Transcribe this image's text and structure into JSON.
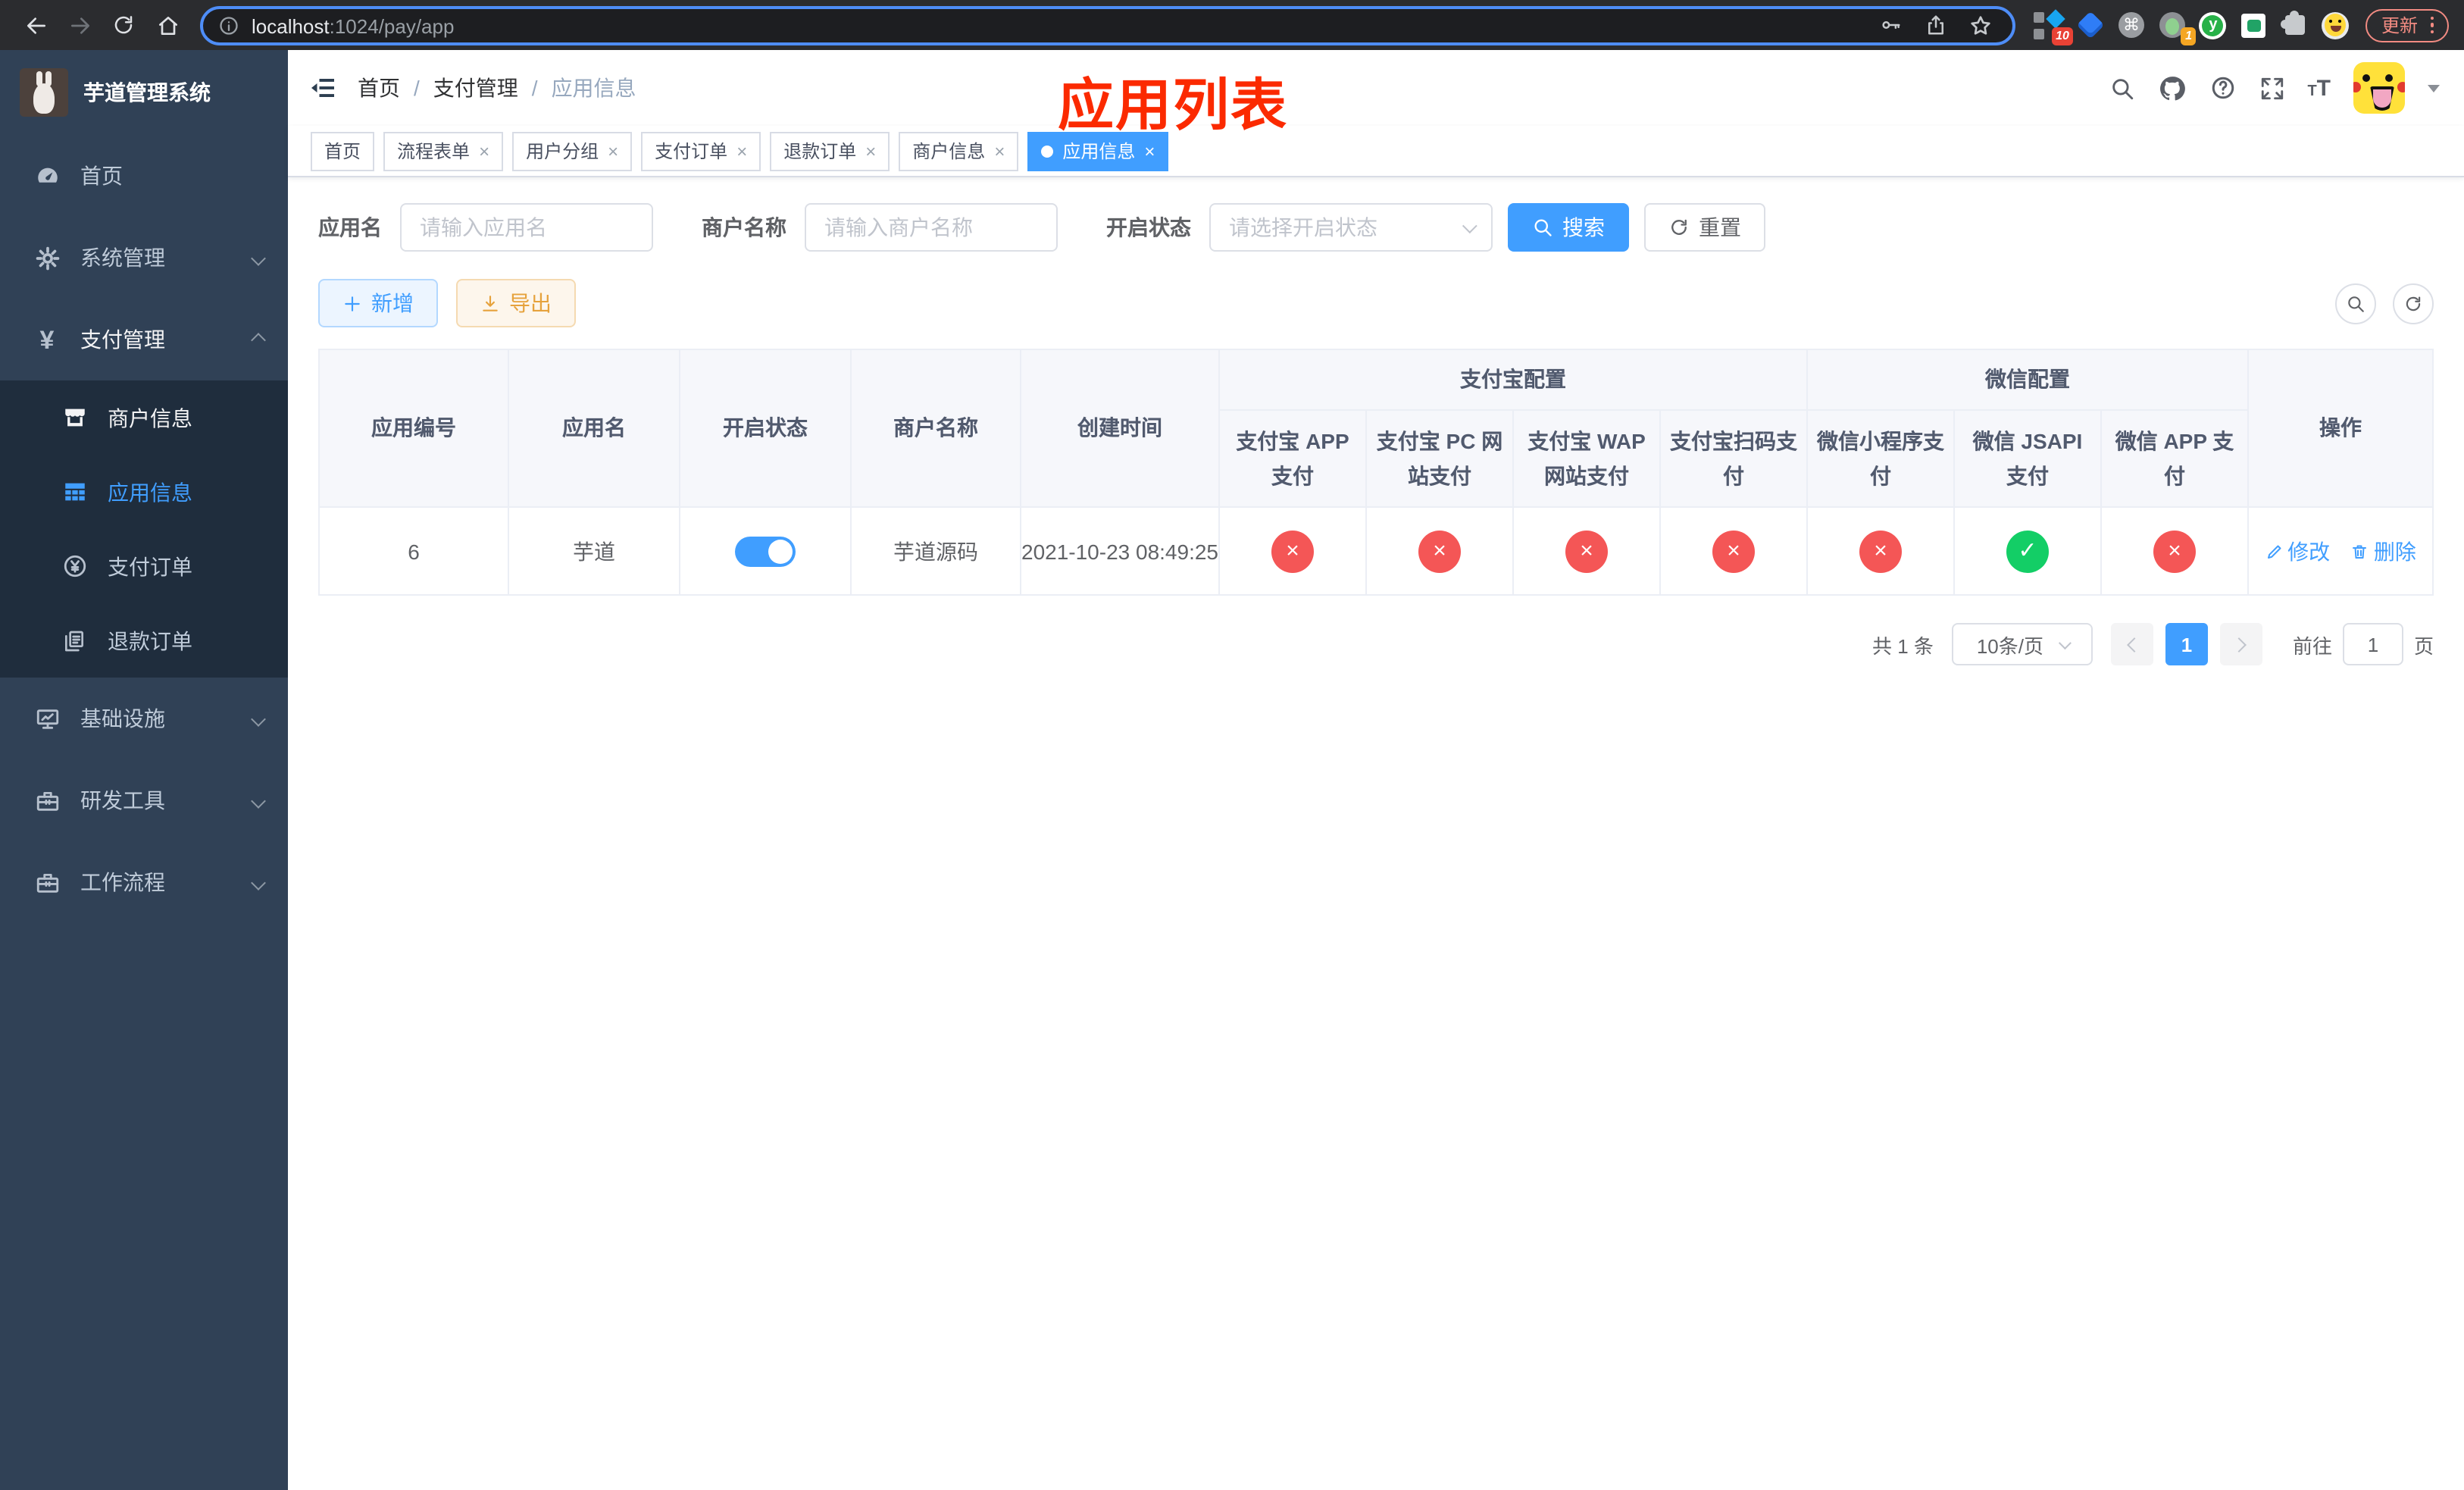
{
  "colors": {
    "accent": "#409eff",
    "success": "#13ce66",
    "danger": "#f45656",
    "warning": "#e6a23c",
    "overlay_red": "#fb2a00",
    "sidebar_bg": "#304156",
    "submenu_bg": "#1f2d3d"
  },
  "browser": {
    "url_host": "localhost",
    "url_path": ":1024/pay/app",
    "update_label": "更新",
    "ext_badge_blue_diamond": "10",
    "ext_badge_green_dot": "1"
  },
  "sidebar": {
    "app_title": "芋道管理系统",
    "home": "首页",
    "system": "系统管理",
    "payment": "支付管理",
    "merchant_info": "商户信息",
    "app_info": "应用信息",
    "pay_order": "支付订单",
    "refund_order": "退款订单",
    "infrastructure": "基础设施",
    "dev_tools": "研发工具",
    "workflow": "工作流程",
    "yuan_glyph": "¥"
  },
  "navbar": {
    "breadcrumb": [
      "首页",
      "支付管理",
      "应用信息"
    ],
    "separator": "/"
  },
  "overlay_title": "应用列表",
  "tabs": [
    {
      "label": "首页"
    },
    {
      "label": "流程表单"
    },
    {
      "label": "用户分组"
    },
    {
      "label": "支付订单"
    },
    {
      "label": "退款订单"
    },
    {
      "label": "商户信息"
    },
    {
      "label": "应用信息"
    }
  ],
  "icons": {
    "close": "×",
    "command": "⌘",
    "star": "☆"
  },
  "filters": {
    "app_name_label": "应用名",
    "app_name_placeholder": "请输入应用名",
    "merchant_label": "商户名称",
    "merchant_placeholder": "请输入商户名称",
    "status_label": "开启状态",
    "status_placeholder": "请选择开启状态",
    "search_label": "搜索",
    "reset_label": "重置"
  },
  "toolbar": {
    "add_label": "新增",
    "export_label": "导出"
  },
  "table": {
    "col_id": "应用编号",
    "col_name": "应用名",
    "col_enabled": "开启状态",
    "col_merchant": "商户名称",
    "col_created": "创建时间",
    "col_actions": "操作",
    "group_alipay": "支付宝配置",
    "group_wechat": "微信配置",
    "pay_columns": [
      "支付宝 APP 支付",
      "支付宝 PC 网站支付",
      "支付宝 WAP 网站支付",
      "支付宝扫码支付",
      "微信小程序支付",
      "微信 JSAPI 支付",
      "微信 APP 支付"
    ],
    "row": {
      "id": "6",
      "name": "芋道",
      "enabled": true,
      "merchant": "芋道源码",
      "created": "2021-10-23 08:49:25",
      "status_glyphs": [
        "×",
        "×",
        "×",
        "×",
        "×",
        "✓",
        "×"
      ],
      "status_classes": [
        "no",
        "no",
        "no",
        "no",
        "no",
        "yes",
        "no"
      ],
      "edit_label": "修改",
      "delete_label": "删除"
    }
  },
  "pagination": {
    "total_label": "共 1 条",
    "page_size": "10条/页",
    "current_page": "1",
    "goto_label": "前往",
    "goto_value": "1",
    "page_unit": "页"
  }
}
